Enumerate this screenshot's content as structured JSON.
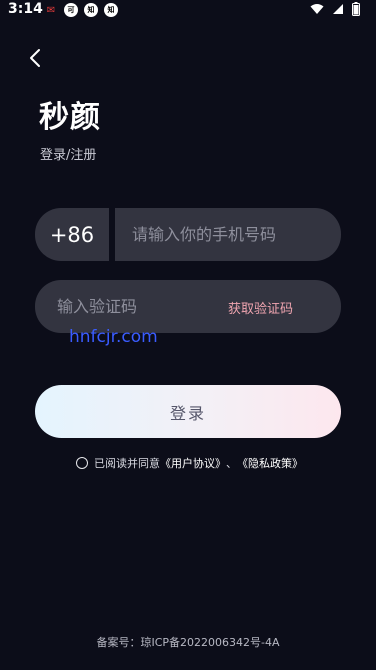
{
  "status_bar": {
    "time": "3:14",
    "notifications": [
      {
        "icon": "message-icon",
        "glyph": "✉"
      },
      {
        "icon": "app-badge-icon",
        "glyph": "可"
      },
      {
        "icon": "app-badge-icon",
        "glyph": "知"
      },
      {
        "icon": "app-badge-icon",
        "glyph": "知"
      }
    ]
  },
  "header": {
    "title": "秒颜",
    "subtitle": "登录/注册"
  },
  "phone": {
    "country_code": "+86",
    "placeholder": "请输入你的手机号码"
  },
  "code": {
    "placeholder": "输入验证码",
    "get_code_label": "获取验证码"
  },
  "watermark": "hnfcjr.com",
  "login_button": "登录",
  "agreement": {
    "prefix": "已阅读并同意",
    "user_agreement": "《用户协议》",
    "separator": "、",
    "privacy_policy": "《隐私政策》"
  },
  "icp": "备案号：琼ICP备2022006342号-4A",
  "colors": {
    "background": "#0c0d19",
    "input_bg": "#333440",
    "accent_pink": "#f0a5b0",
    "watermark_blue": "#3a5cff"
  }
}
